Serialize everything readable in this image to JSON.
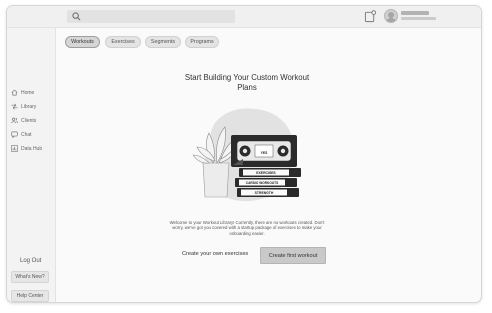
{
  "topbar": {
    "search": {
      "placeholder": ""
    },
    "icons": {
      "search": "search-icon",
      "notifications": "bell-icon",
      "avatar": "user-avatar"
    }
  },
  "sidebar": {
    "items": [
      {
        "label": "Home",
        "icon": "home-icon"
      },
      {
        "label": "Library",
        "icon": "library-arrows-icon"
      },
      {
        "label": "Clients",
        "icon": "clients-icon"
      },
      {
        "label": "Chat",
        "icon": "chat-icon"
      },
      {
        "label": "Data Hub",
        "icon": "bar-chart-icon"
      }
    ],
    "logout_label": "Log Out",
    "whats_new_label": "What's New?",
    "help_center_label": "Help Center"
  },
  "tabs": [
    {
      "label": "Workouts",
      "active": true
    },
    {
      "label": "Exercises",
      "active": false
    },
    {
      "label": "Segments",
      "active": false
    },
    {
      "label": "Programs",
      "active": false
    }
  ],
  "empty_state": {
    "title": "Start Building Your Custom Workout Plans",
    "description": "Welcome to your Workout Library! Currently, there are no workouts created. Don't worry, we've got you covered with a startup package of exercises to make your onboarding easier.",
    "create_own_label": "Create your own exercises",
    "create_first_label": "Create first workout",
    "tape_labels": [
      "YES",
      "EXERCISES",
      "CARDIO WORKOUTS",
      "STRENGTH"
    ]
  },
  "colors": {
    "frame_bg": "#fafafa",
    "sidebar_bg": "#f3f3f3",
    "button_bg": "#c9c9c9",
    "accent_dark": "#2b2b2b"
  }
}
